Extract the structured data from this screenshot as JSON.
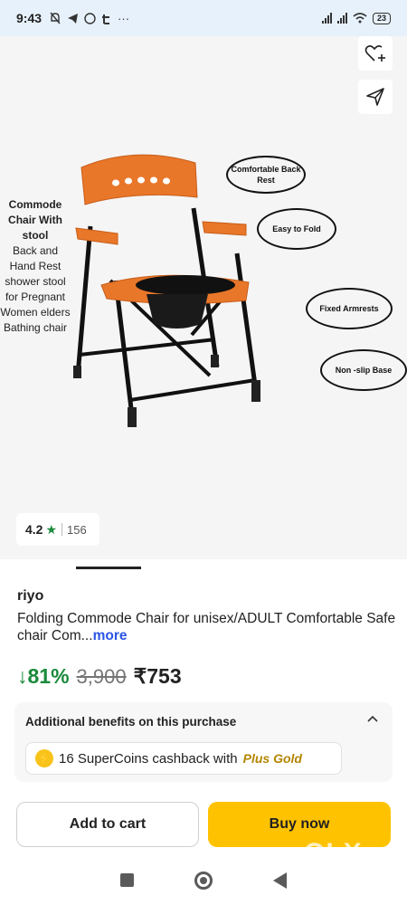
{
  "status_bar": {
    "time": "9:43",
    "battery": "23",
    "notification_icons": [
      "mute-icon",
      "telegram-icon",
      "whatsapp-icon",
      "truecaller-icon",
      "more-dots-icon"
    ],
    "more_dots": "···"
  },
  "gallery": {
    "side_text_title": "Commode Chair With stool",
    "side_text_body": "Back and Hand Rest shower stool for Pregnant Women elders Bathing chair",
    "callouts": {
      "back_rest": "Comfortable Back Rest",
      "fold": "Easy  to Fold",
      "armrests": "Fixed Armrests",
      "base": "Non -slip Base"
    },
    "rating": "4.2",
    "rating_count": "156"
  },
  "product": {
    "brand": "riyo",
    "title": "Folding Commode Chair for unisex/ADULT Comfortable Safe chair Com...",
    "more_label": "more",
    "discount": "↓81%",
    "mrp": "3,900",
    "price": "₹753"
  },
  "benefits": {
    "title": "Additional benefits on this purchase",
    "supercoins_text": "16 SuperCoins cashback with",
    "plus_gold": "Plus Gold"
  },
  "actions": {
    "add_to_cart": "Add to cart",
    "buy_now": "Buy now"
  },
  "watermark": "OLX",
  "colors": {
    "discount_green": "#1b8a3b",
    "buy_now_yellow": "#ffc200",
    "more_link_blue": "#2a55e5",
    "chair_orange": "#e8772a"
  }
}
